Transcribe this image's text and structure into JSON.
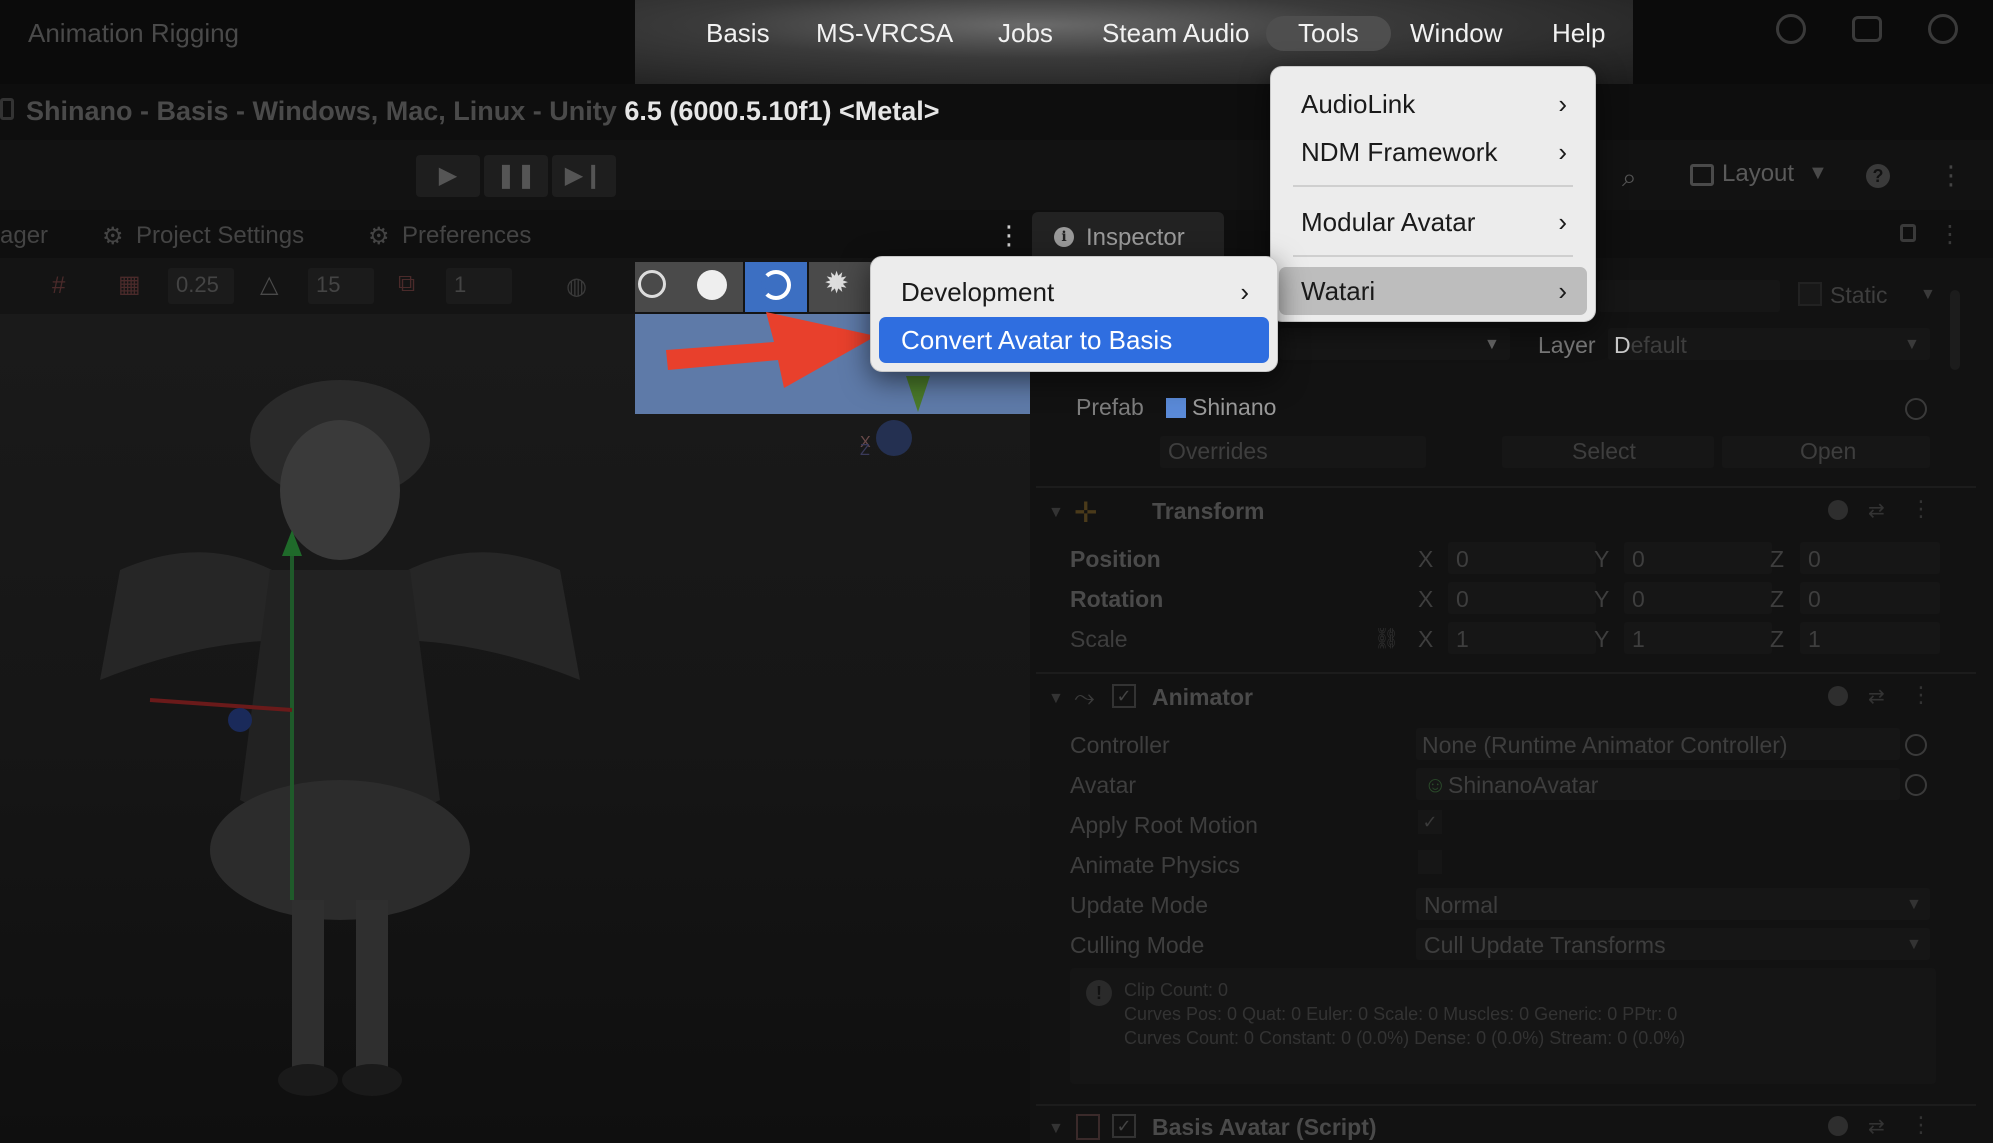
{
  "menubar": {
    "left_label": "Animation Rigging",
    "items": [
      "Basis",
      "MS-VRCSA",
      "Jobs",
      "Steam Audio",
      "Tools",
      "Window",
      "Help"
    ],
    "active_item": "Tools"
  },
  "window": {
    "title_dim": "Shinano - Basis - Windows, Mac, Linux - Unity ",
    "title_bright": "6.5 (6000.5.10f1) <Metal>"
  },
  "toolbar": {
    "layout_label": "Layout"
  },
  "tabs": {
    "manager_partial": "ager",
    "project_settings": "Project Settings",
    "preferences": "Preferences",
    "inspector": "Inspector"
  },
  "scene_toolbar": {
    "snap_value": "0.25",
    "angle_value": "15",
    "scale_value": "1"
  },
  "tools_menu": {
    "items": [
      {
        "label": "AudioLink",
        "submenu": true
      },
      {
        "label": "NDM Framework",
        "submenu": true
      },
      {
        "label": "Modular Avatar",
        "submenu": true
      },
      {
        "label": "Watari",
        "submenu": true,
        "highlighted": true
      }
    ]
  },
  "watari_submenu": {
    "items": [
      {
        "label": "Development",
        "submenu": true
      },
      {
        "label": "Convert Avatar to Basis",
        "selected": true
      }
    ]
  },
  "inspector": {
    "static_label": "Static",
    "layer_label": "Layer",
    "layer_value_cursor": "D",
    "layer_value": "efault",
    "prefab_label": "Prefab",
    "prefab_value": "Shinano",
    "overrides": "Overrides",
    "select": "Select",
    "open": "Open",
    "transform": {
      "title": "Transform",
      "rows": [
        {
          "label": "Position",
          "x": "0",
          "y": "0",
          "z": "0"
        },
        {
          "label": "Rotation",
          "x": "0",
          "y": "0",
          "z": "0"
        },
        {
          "label": "Scale",
          "x": "1",
          "y": "1",
          "z": "1"
        }
      ]
    },
    "animator": {
      "title": "Animator",
      "controller_label": "Controller",
      "controller_value": "None (Runtime Animator Controller)",
      "avatar_label": "Avatar",
      "avatar_value": "ShinanoAvatar",
      "apply_root_motion": "Apply Root Motion",
      "animate_physics": "Animate Physics",
      "update_mode_label": "Update Mode",
      "update_mode_value": "Normal",
      "culling_mode_label": "Culling Mode",
      "culling_mode_value": "Cull Update Transforms",
      "info_line1": "Clip Count: 0",
      "info_line2": "Curves Pos: 0 Quat: 0 Euler: 0 Scale: 0 Muscles: 0 Generic: 0 PPtr: 0",
      "info_line3": "Curves Count: 0 Constant: 0 (0.0%) Dense: 0 (0.0%) Stream: 0 (0.0%)"
    },
    "basis_avatar": {
      "title": "Basis Avatar (Script)"
    }
  },
  "axis_labels": {
    "x": "X",
    "y": "Y",
    "z": "Z"
  },
  "colors": {
    "menu_bg": "#ececec",
    "selection_blue": "#2f6ee0",
    "arrow_red": "#e8402c"
  }
}
